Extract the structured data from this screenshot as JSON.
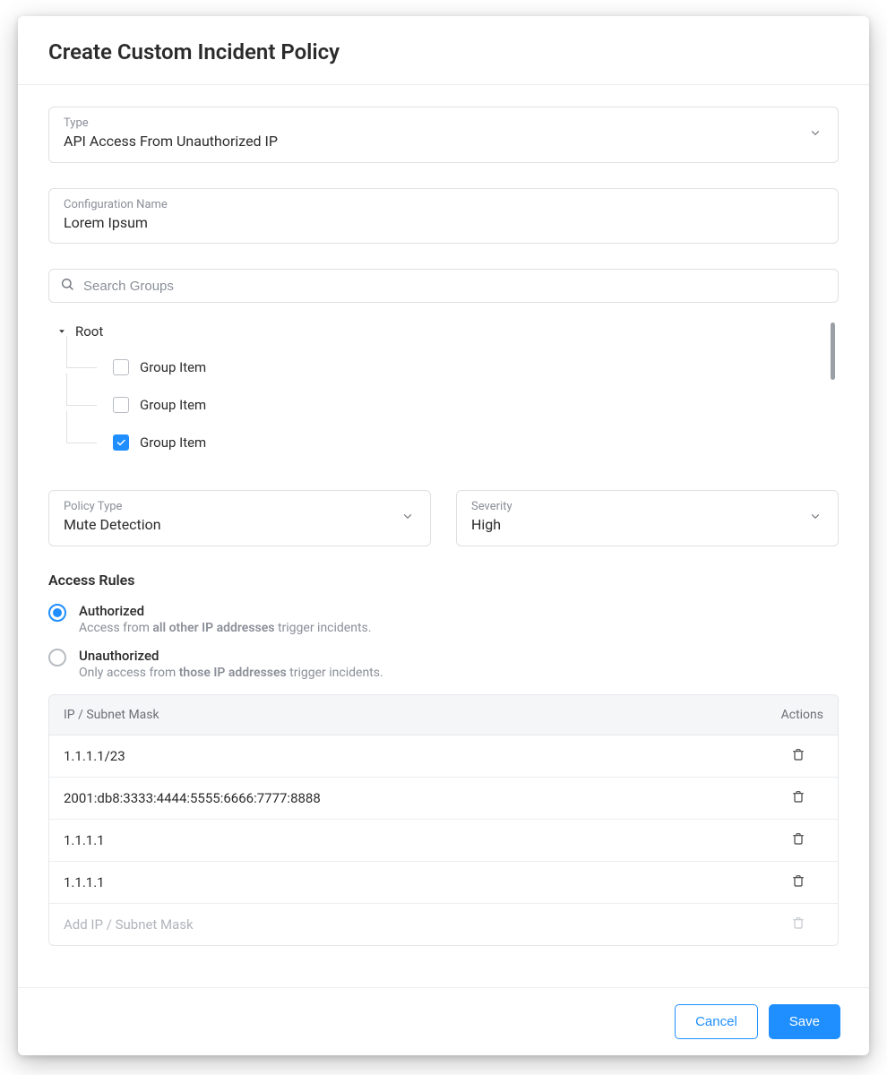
{
  "header": {
    "title": "Create Custom Incident Policy"
  },
  "type_field": {
    "label": "Type",
    "value": "API Access From Unauthorized IP"
  },
  "config_name_field": {
    "label": "Configuration Name",
    "value": "Lorem Ipsum"
  },
  "search": {
    "placeholder": "Search Groups"
  },
  "tree": {
    "root_label": "Root",
    "items": [
      {
        "label": "Group Item",
        "checked": false
      },
      {
        "label": "Group Item",
        "checked": false
      },
      {
        "label": "Group Item",
        "checked": true
      }
    ]
  },
  "policy_type": {
    "label": "Policy Type",
    "value": "Mute Detection"
  },
  "severity": {
    "label": "Severity",
    "value": "High"
  },
  "access_rules": {
    "title": "Access Rules",
    "options": [
      {
        "label": "Authorized",
        "selected": true,
        "desc_prefix": "Access from ",
        "desc_bold": "all other IP addresses",
        "desc_suffix": " trigger incidents."
      },
      {
        "label": "Unauthorized",
        "selected": false,
        "desc_prefix": "Only access from ",
        "desc_bold": "those IP addresses",
        "desc_suffix": " trigger incidents."
      }
    ]
  },
  "ip_table": {
    "header_ip": "IP / Subnet Mask",
    "header_actions": "Actions",
    "rows": [
      {
        "value": "1.1.1.1/23"
      },
      {
        "value": "2001:db8:3333:4444:5555:6666:7777:8888"
      },
      {
        "value": "1.1.1.1"
      },
      {
        "value": "1.1.1.1"
      }
    ],
    "add_placeholder": "Add IP / Subnet Mask"
  },
  "footer": {
    "cancel": "Cancel",
    "save": "Save"
  }
}
